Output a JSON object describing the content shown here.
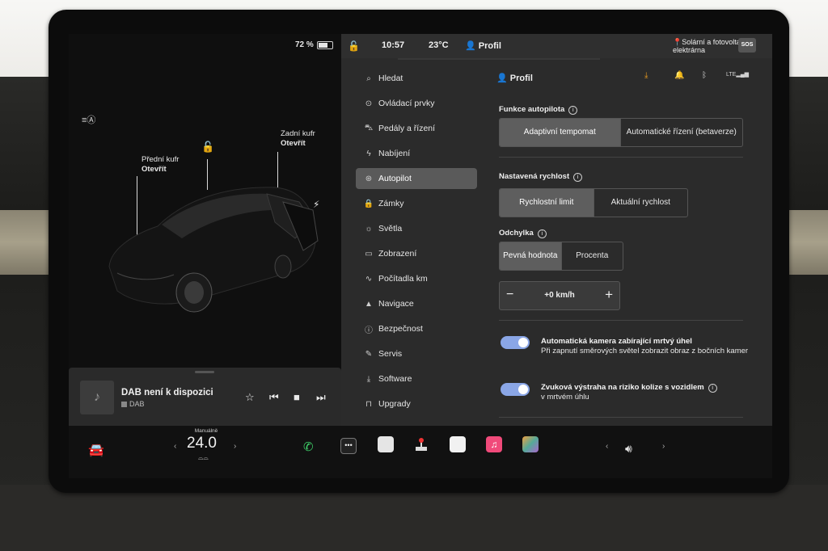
{
  "left": {
    "battery": "72 %",
    "battery_level": 0.72,
    "frunk": {
      "label": "Přední kufr",
      "action": "Otevřít"
    },
    "trunk": {
      "label": "Zadní kufr",
      "action": "Otevřít"
    }
  },
  "media": {
    "title": "DAB není k dispozici",
    "source": "DAB"
  },
  "status": {
    "time": "10:57",
    "temp": "23°C",
    "profile": "Profil",
    "location": "Solární a fotovoltaická\nelektrárna",
    "sos": "SOS"
  },
  "nav": [
    {
      "label": "Hledat",
      "icon": "search-icon"
    },
    {
      "label": "Ovládací prvky",
      "icon": "toggle-icon"
    },
    {
      "label": "Pedály a řízení",
      "icon": "car-icon"
    },
    {
      "label": "Nabíjení",
      "icon": "bolt-icon"
    },
    {
      "label": "Autopilot",
      "icon": "steering-wheel-icon"
    },
    {
      "label": "Zámky",
      "icon": "lock-icon"
    },
    {
      "label": "Světla",
      "icon": "sun-icon"
    },
    {
      "label": "Zobrazení",
      "icon": "display-icon"
    },
    {
      "label": "Počítadla km",
      "icon": "odometer-icon"
    },
    {
      "label": "Navigace",
      "icon": "navigation-icon"
    },
    {
      "label": "Bezpečnost",
      "icon": "safety-icon"
    },
    {
      "label": "Servis",
      "icon": "wrench-icon"
    },
    {
      "label": "Software",
      "icon": "download-icon"
    },
    {
      "label": "Upgrady",
      "icon": "bag-icon"
    }
  ],
  "panel": {
    "header": "Profil",
    "autopilot_features": {
      "title": "Funkce autopilota",
      "options": [
        "Adaptivní tempomat",
        "Automatické řízení (betaverze)"
      ]
    },
    "set_speed": {
      "title": "Nastavená rychlost",
      "options": [
        "Rychlostní limit",
        "Aktuální rychlost"
      ]
    },
    "offset": {
      "title": "Odchylka",
      "options": [
        "Pevná hodnota",
        "Procenta"
      ],
      "value": "+0 km/h"
    },
    "blind_spot_camera": {
      "title": "Automatická kamera zabírající mrtvý úhel",
      "desc": "Při zapnutí směrových světel zobrazit obraz z bočních kamer"
    },
    "blind_spot_chime": {
      "title": "Zvuková výstraha na riziko kolize s vozidlem",
      "desc": "v mrtvém úhlu"
    }
  },
  "dock": {
    "climate_mode": "Manuálně",
    "temperature": "24.0"
  }
}
